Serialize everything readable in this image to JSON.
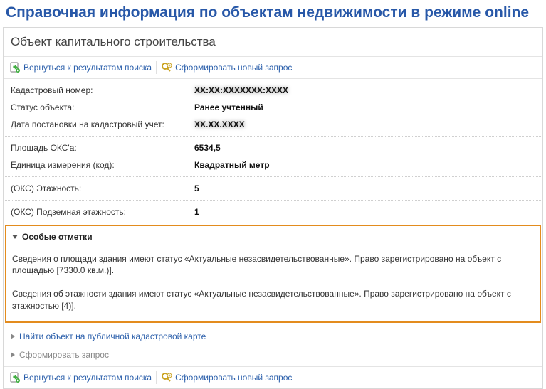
{
  "page_title": "Справочная информация по объектам недвижимости в режиме online",
  "section_title": "Объект капитального строительства",
  "toolbar": {
    "back_label": "Вернуться к результатам поиска",
    "new_label": "Сформировать новый запрос"
  },
  "fields_a": [
    {
      "label": "Кадастровый номер:",
      "value": "XX:XX:XXXXXXX:XXXX",
      "blur": true
    },
    {
      "label": "Статус объекта:",
      "value": "Ранее учтенный",
      "blur": false
    },
    {
      "label": "Дата постановки на кадастровый учет:",
      "value": "XX.XX.XXXX",
      "blur": true
    }
  ],
  "fields_b": [
    {
      "label": "Площадь ОКС'а:",
      "value": "6534,5"
    },
    {
      "label": "Единица измерения (код):",
      "value": "Квадратный метр"
    }
  ],
  "fields_c": [
    {
      "label": "(ОКС) Этажность:",
      "value": "5"
    }
  ],
  "fields_d": [
    {
      "label": "(ОКС) Подземная этажность:",
      "value": "1"
    }
  ],
  "special": {
    "header": "Особые отметки",
    "note_area": "Сведения о площади здания имеют статус «Актуальные незасвидетельствованные». Право зарегистрировано на объект с площадью [7330.0 кв.м.)].",
    "note_floors": "Сведения об этажности здания имеют статус «Актуальные незасвидетельствованные». Право зарегистрировано на объект с этажностью [4)]."
  },
  "lower_links": {
    "find_object": "Найти объект на публичной кадастровой карте",
    "form_request": "Сформировать запрос"
  }
}
